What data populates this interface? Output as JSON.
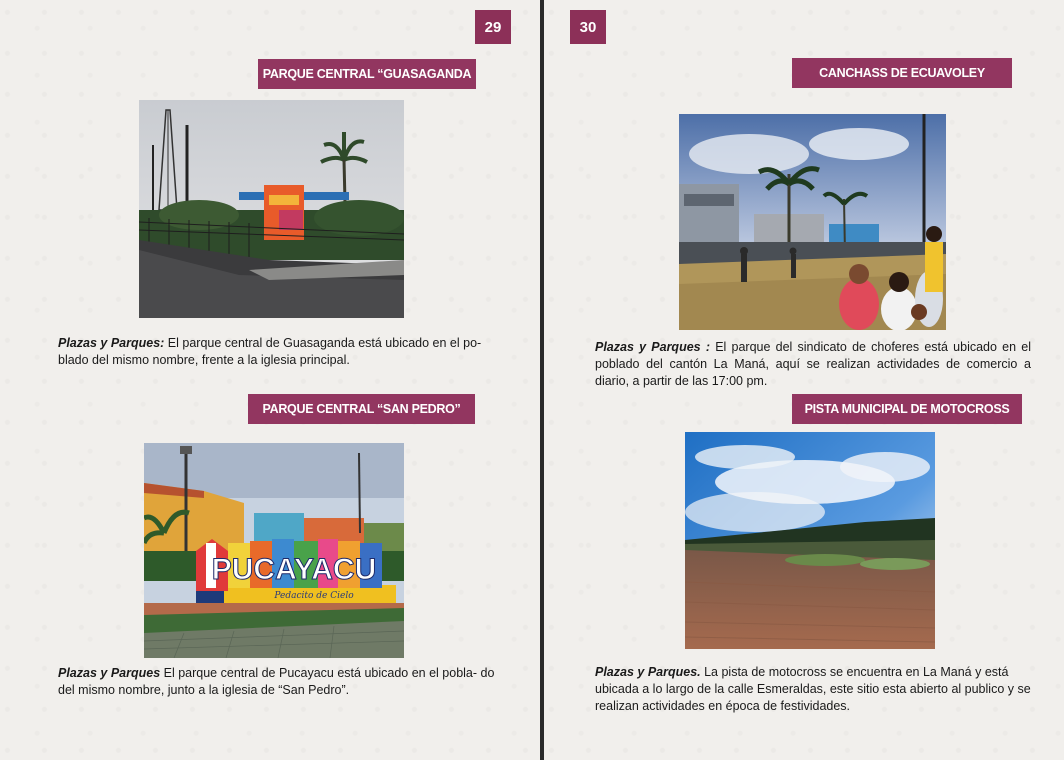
{
  "left_page": {
    "page_number": "29",
    "sections": [
      {
        "banner": "PARQUE CENTRAL “GUASAGANDA",
        "photo": "photo-guasaganda-park",
        "category": "Plazas y Parques:",
        "text": " El parque central de Guasaganda está ubicado en el po- blado del mismo nombre, frente a la iglesia principal."
      },
      {
        "banner": "PARQUE CENTRAL “SAN PEDRO”",
        "photo": "photo-pucayacu-sign",
        "sign_text": "PUCAYACU",
        "sign_subtitle": "Pedacito de Cielo",
        "category": "Plazas y Parques",
        "text": " El parque central de Pucayacu está ubicado en el pobla- do del mismo nombre, junto a la iglesia de “San Pedro”."
      }
    ]
  },
  "right_page": {
    "page_number": "30",
    "sections": [
      {
        "banner": "CANCHASS DE ECUAVOLEY",
        "photo": "photo-ecuavoley-court",
        "category": "Plazas y Parques :",
        "text": " El parque del sindicato de choferes está ubicado en el poblado del cantón La Maná, aquí se realizan actividades de comercio a diario, a partir de las 17:00 pm."
      },
      {
        "banner": "PISTA MUNICIPAL DE MOTOCROSS",
        "photo": "photo-motocross-track",
        "category": "Plazas y Parques.",
        "text": " La pista de motocross se encuentra en La Maná y está ubicada a lo largo de la calle Esmeraldas, este sitio esta abierto al publico y se realizan actividades en época de festividades."
      }
    ]
  },
  "colors": {
    "accent": "#923660",
    "page_bg": "#f1efec",
    "spine": "#2a2a2a"
  }
}
